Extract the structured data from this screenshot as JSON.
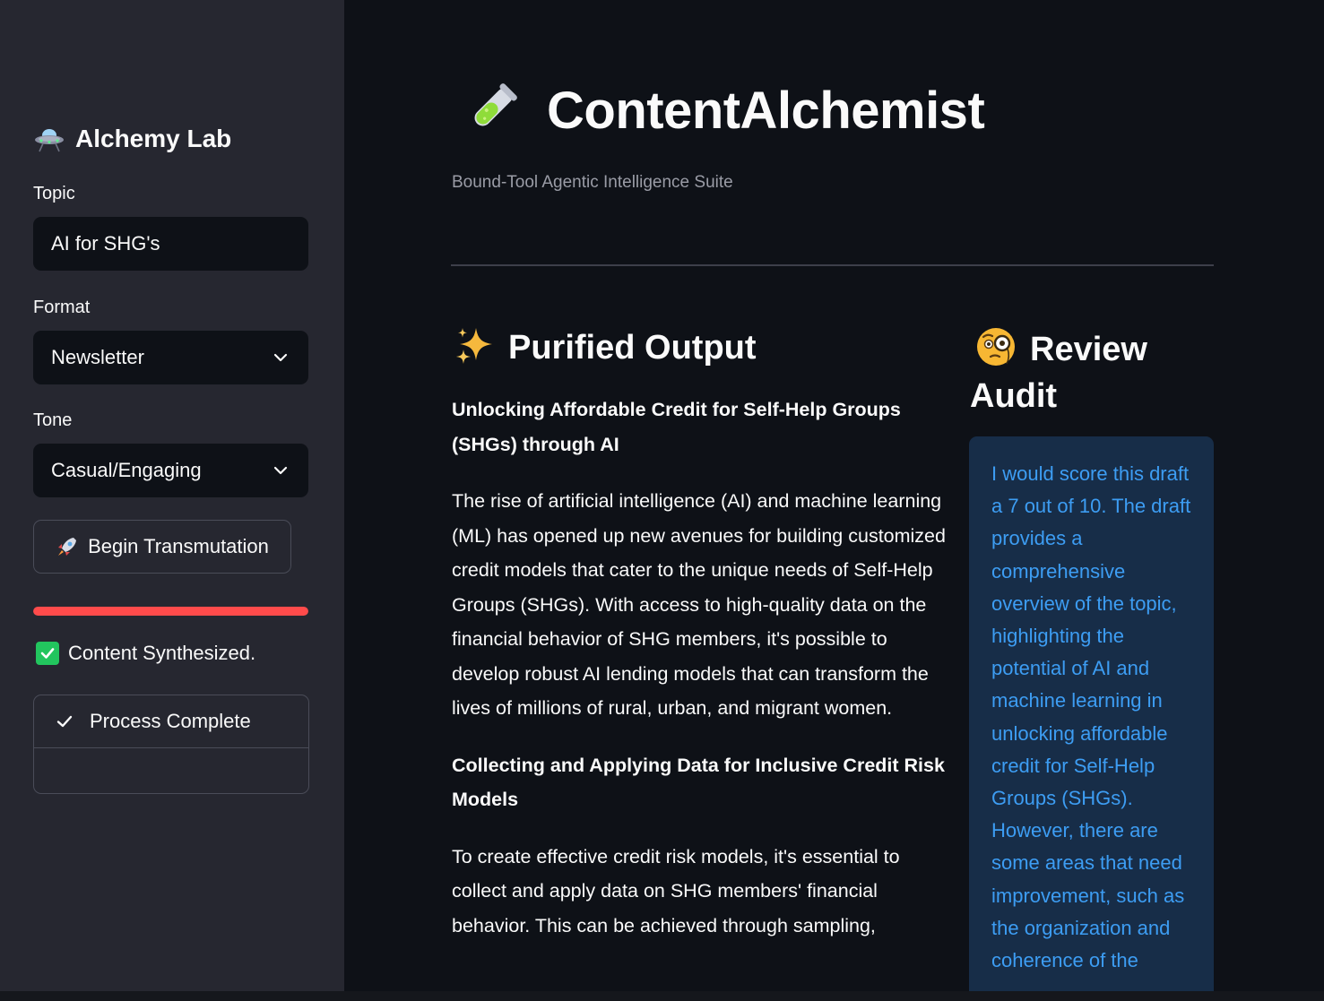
{
  "sidebar": {
    "title": "Alchemy Lab",
    "title_icon": "ufo-icon",
    "topic": {
      "label": "Topic",
      "value": "AI for SHG's"
    },
    "format": {
      "label": "Format",
      "value": "Newsletter"
    },
    "tone": {
      "label": "Tone",
      "value": "Casual/Engaging"
    },
    "run_button": {
      "label": "Begin Transmutation",
      "icon": "rocket-icon"
    },
    "progress": {
      "percent": 100,
      "color": "#ff4b4b"
    },
    "synth_status": "Content Synthesized.",
    "process_status": "Process Complete"
  },
  "header": {
    "title": "ContentAlchemist",
    "title_icon": "test-tube-icon",
    "subtitle": "Bound-Tool Agentic Intelligence Suite"
  },
  "output": {
    "heading": "Purified Output",
    "heading_icon": "sparkles-icon",
    "article": [
      {
        "type": "heading",
        "text": "Unlocking Affordable Credit for Self-Help Groups (SHGs) through AI"
      },
      {
        "type": "paragraph",
        "text": "The rise of artificial intelligence (AI) and machine learning (ML) has opened up new avenues for building customized credit models that cater to the unique needs of Self-Help Groups (SHGs). With access to high-quality data on the financial behavior of SHG members, it's possible to develop robust AI lending models that can transform the lives of millions of rural, urban, and migrant women."
      },
      {
        "type": "heading",
        "text": "Collecting and Applying Data for Inclusive Credit Risk Models"
      },
      {
        "type": "paragraph",
        "text": "To create effective credit risk models, it's essential to collect and apply data on SHG members' financial behavior. This can be achieved through sampling,"
      }
    ]
  },
  "review": {
    "heading": "Review Audit",
    "heading_icon": "monocle-face-icon",
    "text": "I would score this draft a 7 out of 10. The draft provides a comprehensive overview of the topic, highlighting the potential of AI and machine learning in unlocking affordable credit for Self-Help Groups (SHGs). However, there are some areas that need improvement, such as the organization and coherence of the"
  },
  "colors": {
    "background": "#0e1117",
    "sidebar": "#262730",
    "accent": "#ff4b4b",
    "info_bg": "#172d48",
    "info_text": "#3d9df3"
  }
}
